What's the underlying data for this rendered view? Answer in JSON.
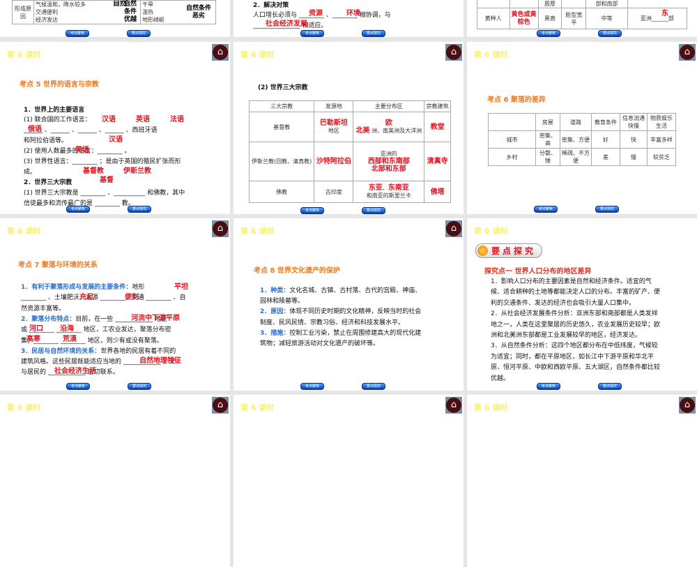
{
  "lesson_label": "第 6 课时",
  "buttons": {
    "left": "考点聚焦",
    "right": "要点探究"
  },
  "s1": {
    "top": "自然",
    "row_head": "形成原因",
    "good": [
      "气候温和，降水较多",
      "交通便利",
      "经济发达"
    ],
    "good_label": "自然条件优越",
    "bad": [
      "干旱",
      "湿热",
      "地形崎岖"
    ],
    "bad_label": "自然条件恶劣"
  },
  "s2": {
    "heading": "2．解决对策",
    "line1": "人口增长必须与 ________ 、________ 相协调，与",
    "line2": "_______________ 相适应。",
    "a1": "资源",
    "a2": "环境",
    "a3": "社会经济发展"
  },
  "s3": {
    "prev_cells": [
      "唇厚",
      "部和南部"
    ],
    "race": "黄种人",
    "skin": "黄色或黄棕色",
    "hair": "黑直",
    "face": "脸型宽平",
    "height": "中等",
    "dist": "亚洲______部",
    "dist_ans": "东"
  },
  "s4": {
    "title": "考点  5    世界的语言与宗教",
    "h1": "1．世界上的主要语言",
    "l1": "(1) 联合国的工作语言：",
    "l2": "______ 、______ 、______ 、______ 、西班牙语",
    "l3": "和阿拉伯语等。",
    "l4": "(2) 使用人数最多的语言：________ 。",
    "l5": "(3) 世界性语言：________ ；是由于英国的殖民扩张而形",
    "l6": "成。",
    "h2": "2．世界三大宗教",
    "l7": "(1) 世界三大宗教是 ________ 、__________ 和佛教，其中",
    "l8": "信徒最多和流传最广的是 ________ 教。",
    "ans": [
      "汉语",
      "英语",
      "法语",
      "俄语",
      "汉语",
      "英语",
      "基督教",
      "伊斯兰教",
      "基督"
    ]
  },
  "s5": {
    "title": "(2) 世界三大宗教",
    "headers": [
      "三大宗教",
      "发源地",
      "主要分布区",
      "宗教建筑"
    ],
    "rows": [
      {
        "name": "基督教",
        "origin": "地区",
        "origin_ans": "巴勒斯坦",
        "dist": "洲、南美洲及大洋洲",
        "dist_ans": [
          "欧",
          "北美"
        ],
        "building": "教堂"
      },
      {
        "name": "伊斯兰教(回教、清真教)",
        "origin_ans": "沙特阿拉伯",
        "dist": "亚洲的",
        "dist_ans": [
          "西部和东南部",
          "北部和东部"
        ],
        "building": "清真寺"
      },
      {
        "name": "佛教",
        "origin": "古印度",
        "dist": "和南亚的斯里兰卡",
        "dist_ans": [
          "东亚",
          "东南亚"
        ],
        "building": "佛塔"
      }
    ]
  },
  "s6": {
    "title": "考点  6    聚落的差异",
    "headers": [
      "",
      "房屋",
      "道路",
      "教育条件",
      "信息流通快慢",
      "物质娱乐生活"
    ],
    "rows": [
      [
        "城市",
        "密集、高",
        "密集、方便",
        "好",
        "快",
        "丰富多样"
      ],
      [
        "乡村",
        "分散、矮",
        "稀疏、不方便",
        "差",
        "慢",
        "较贫乏"
      ]
    ]
  },
  "s7": {
    "title": "考点  7    聚落与环境的关系",
    "lines": [
      {
        "b": "1．有利于聚落形成与发展的主要条件：",
        "t": "地形"
      },
      {
        "b": "",
        "t": "________ 、土壤肥沃、水源 ________、交通 ________ 、自"
      },
      {
        "b": "",
        "t": "然资源丰富等。"
      },
      {
        "b": "2．聚落分布特点：",
        "t": "目前，在一些 ____________ 地区"
      },
      {
        "b": "",
        "t": "或 ________ ________ 地区，工农业发达，聚落分布密"
      },
      {
        "b": "",
        "t": "集；________ ________ 地区，则少有或没有聚落。"
      },
      {
        "b": "3．民居与自然环境的关系：",
        "t": "世界各地的民居有着不同的"
      },
      {
        "b": "",
        "t": "建筑风格。这些民居既能适应当地的 ____________ ，又"
      },
      {
        "b": "",
        "t": "与居民的 ____________ 密切联系。"
      }
    ],
    "ans": [
      "平坦",
      "充足",
      "便利",
      "河流中下游平原",
      "河口",
      "沿海",
      "高寒",
      "荒漠",
      "自然地理特征",
      "社会经济生活"
    ]
  },
  "s8": {
    "title": "考点  8    世界文化遗产的保护",
    "lines": [
      {
        "b": "1．种类：",
        "t": "文化名城、古镇、古村落、古代的宫殿、神庙、"
      },
      {
        "b": "",
        "t": "园林和陵墓等。"
      },
      {
        "b": "2．原因：",
        "t": "体现不同历史时期的文化精神，反映当时的社会"
      },
      {
        "b": "",
        "t": "制度、民风民情、宗教习俗、经济和科技发展水平。"
      },
      {
        "b": "3．措施：",
        "t": "控制工业污染，禁止在周围修建高大的现代化建"
      },
      {
        "b": "",
        "t": "筑物；减轻旅游活动对文化遗产的破坏等。"
      }
    ]
  },
  "s9": {
    "banner": "要点探究",
    "title": "探究点一    世界人口分布的地区差异",
    "lines": [
      "1．影响人口分布的主要因素是自然和经济条件。适宜的气",
      "候、适合耕种的土地等都能决定人口的分布。丰富的矿产、便",
      "利的交通条件、发达的经济也会吸引大量人口集中。",
      "2．从社会经济发展条件分析：亚洲东部和南部都是人类发祥",
      "地之一，人类在这里聚居的历史悠久，农业发展历史较早；欧",
      "洲和北美洲东部都是工业发展较早的地区，经济发达。",
      "3．从自然条件分析：这四个地区都分布在中低纬度，气候较",
      "为适宜；同时，都在平原地区，如长江中下游平原和华北平",
      "原、恒河平原、中欧和西欧平原、五大湖区，自然条件都比较",
      "优越。"
    ]
  }
}
